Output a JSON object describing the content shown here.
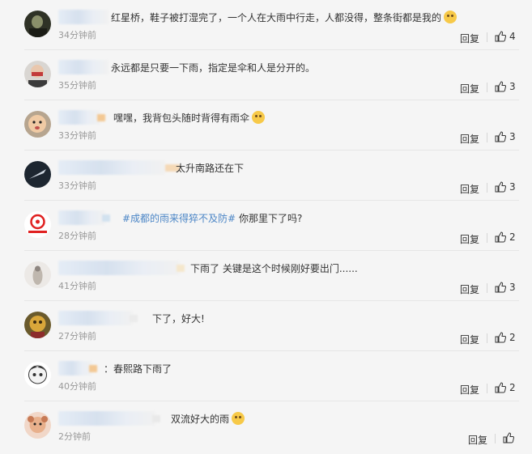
{
  "comments": [
    {
      "text": "红星桥，鞋子被打湿完了，一个人在大雨中行走，人都没得，整条街都是我的",
      "emoji": true,
      "time": "34分钟前",
      "reply": "回复",
      "likes": "4"
    },
    {
      "text": "永远都是只要一下雨，指定是伞和人是分开的。",
      "time": "35分钟前",
      "reply": "回复",
      "likes": "3"
    },
    {
      "text": "嘿嘿，我背包头随时背得有雨伞",
      "emoji": true,
      "time": "33分钟前",
      "reply": "回复",
      "likes": "3"
    },
    {
      "text": "太升南路还在下",
      "time": "33分钟前",
      "reply": "回复",
      "likes": "3"
    },
    {
      "tag": "#成都的雨来得猝不及防#",
      "text": " 你那里下了吗?",
      "time": "28分钟前",
      "reply": "回复",
      "likes": "2"
    },
    {
      "text": "下雨了 关键是这个时候刚好要出门......",
      "time": "41分钟前",
      "reply": "回复",
      "likes": "3"
    },
    {
      "text": "下了，好大!",
      "time": "27分钟前",
      "reply": "回复",
      "likes": "2"
    },
    {
      "text": "：春熙路下雨了",
      "time": "40分钟前",
      "reply": "回复",
      "likes": "2"
    },
    {
      "text": "双流好大的雨",
      "emoji": true,
      "time": "2分钟前",
      "reply": "回复",
      "likes": ""
    }
  ],
  "colors": {
    "background": "#f5f5f5",
    "text": "#333333",
    "time": "#999999",
    "topic": "#4c86c6"
  }
}
